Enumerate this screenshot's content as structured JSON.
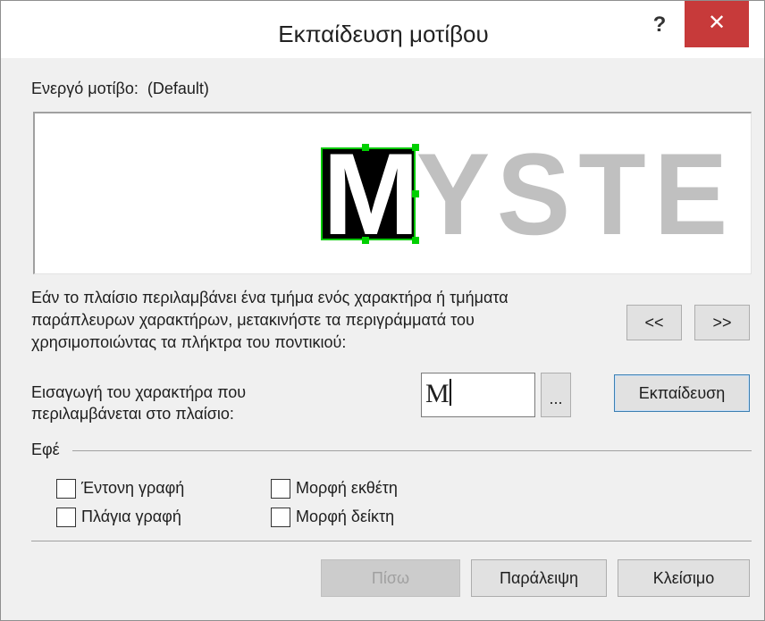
{
  "window": {
    "title": "Εκπαίδευση μοτίβου",
    "help_label": "?",
    "close_label": "✕"
  },
  "active_pattern": {
    "label": "Ενεργό μοτίβο:",
    "value": "(Default)"
  },
  "preview": {
    "selected_char": "M",
    "following_chars": [
      "Y",
      "S",
      "T",
      "E"
    ],
    "colors": {
      "selection_bg": "#000000",
      "selection_border": "#00c800",
      "char_gray": "#c0c0c0"
    }
  },
  "instructions": [
    "Εάν το πλαίσιο περιλαμβάνει ένα τμήμα ενός χαρακτήρα ή τμήματα",
    "παράπλευρων χαρακτήρων, μετακινήστε τα περιγράμματά του",
    "χρησιμοποιώντας τα πλήκτρα του ποντικιού:"
  ],
  "nav": {
    "prev_label": "<<",
    "next_label": ">>"
  },
  "character_entry": {
    "label_line1": "Εισαγωγή του χαρακτήρα που",
    "label_line2": "περιλαμβάνεται στο πλαίσιο:",
    "value": "M",
    "browse_label": "...",
    "train_label": "Εκπαίδευση"
  },
  "effects": {
    "label": "Εφέ",
    "options": [
      {
        "label": "Έντονη γραφή",
        "checked": false
      },
      {
        "label": "Πλάγια γραφή",
        "checked": false
      },
      {
        "label": "Μορφή εκθέτη",
        "checked": false
      },
      {
        "label": "Μορφή δείκτη",
        "checked": false
      }
    ]
  },
  "footer": {
    "back_label": "Πίσω",
    "skip_label": "Παράλειψη",
    "close_label": "Κλείσιμο"
  }
}
